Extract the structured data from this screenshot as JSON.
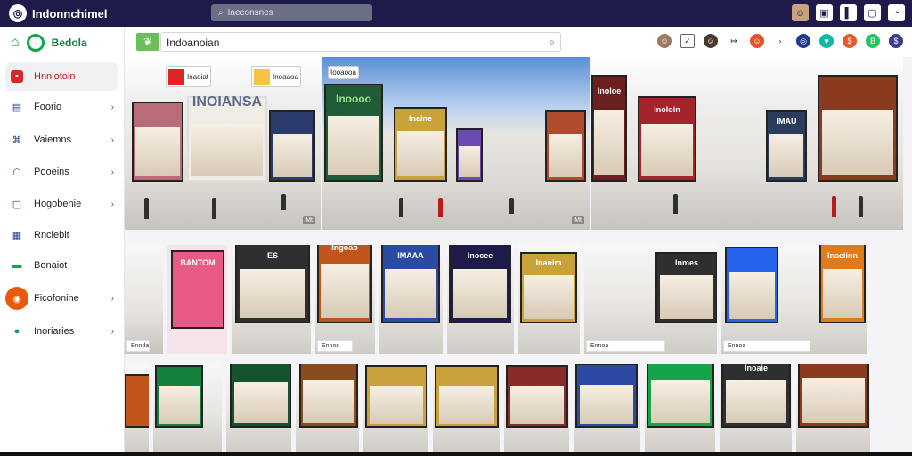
{
  "app": {
    "title": "Indonnchimel",
    "logo_icon": "globe-icon"
  },
  "top_search": {
    "value": "Iaeconsnes"
  },
  "top_icons": [
    "avatar",
    "bag-icon",
    "flag-icon",
    "chat-icon",
    "bell-icon"
  ],
  "sidebar": {
    "brand": "Bedola",
    "items": [
      {
        "label": "Hnnlotoin",
        "icon": "store-icon",
        "active": true,
        "chevron": false
      },
      {
        "label": "Foorio",
        "icon": "list-icon",
        "chevron": true
      },
      {
        "label": "Vaiemns",
        "icon": "tag-icon",
        "chevron": true
      },
      {
        "label": "Pooeins",
        "icon": "user-icon",
        "chevron": true
      },
      {
        "label": "Hogobenie",
        "icon": "chat-icon",
        "chevron": true
      },
      {
        "label": "Rnclebit",
        "icon": "calendar-icon",
        "chevron": false
      },
      {
        "label": "Bonaiot",
        "icon": "wallet-icon",
        "chevron": false
      },
      {
        "label": "Ficofonine",
        "icon": "orange-circle-icon",
        "chevron": true
      },
      {
        "label": "Inoriaries",
        "icon": "location-icon",
        "chevron": true
      }
    ]
  },
  "toolbar": {
    "search_value": "Indoanoian"
  },
  "hero": [
    {
      "signs": [
        "INOIANSA"
      ],
      "badges": [
        "Inaoiat",
        "Inoaaoa"
      ],
      "corner": "Mt"
    },
    {
      "signs": [
        "Inoooo",
        "Inaine"
      ],
      "badges": [
        "Iooaooa"
      ],
      "corner": "Mt"
    },
    {
      "signs": [
        "Inoloe",
        "Inoloin",
        "IMAU"
      ],
      "badges": []
    }
  ],
  "gallery_row1": [
    "Ennda",
    "Ennos",
    "Ennoa",
    "Ennoa",
    "Ennoa",
    "Ennoa"
  ],
  "gallery_row1_signs": [
    "BANTOM",
    "ES",
    "Ingoab",
    "IMAAA",
    "Inocee",
    "Inanim",
    "Inmes",
    "Inaeiinn",
    "Inoaie"
  ]
}
